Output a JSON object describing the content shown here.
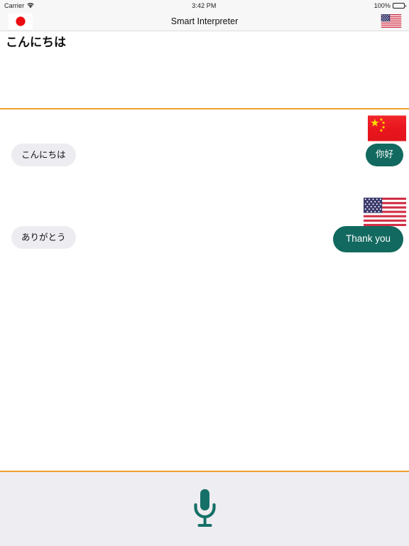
{
  "status_bar": {
    "carrier": "Carrier",
    "wifi_icon": "wifi-icon",
    "time": "3:42 PM",
    "battery_percent": "100%",
    "battery_icon": "battery-full-icon"
  },
  "nav_bar": {
    "title": "Smart Interpreter",
    "left_flag": "flag-japan-icon",
    "right_flag": "flag-united-states-icon"
  },
  "transcript": {
    "text": "こんにちは"
  },
  "conversation": {
    "messages": [
      {
        "source_flag": "flag-japan-icon",
        "source_text": "こんにちは",
        "target_flag": "flag-china-icon",
        "target_text": "你好"
      },
      {
        "source_flag": "flag-japan-icon",
        "source_text": "ありがとう",
        "target_flag": "flag-united-states-icon",
        "target_text": "Thank you"
      }
    ]
  },
  "footer": {
    "mic_icon": "microphone-icon"
  },
  "colors": {
    "accent_orange": "#f0a030",
    "bubble_teal": "#12695f",
    "bubble_gray": "#edecf1",
    "footer_bg": "#eeedf1",
    "flag_red": "#ed0b12"
  }
}
